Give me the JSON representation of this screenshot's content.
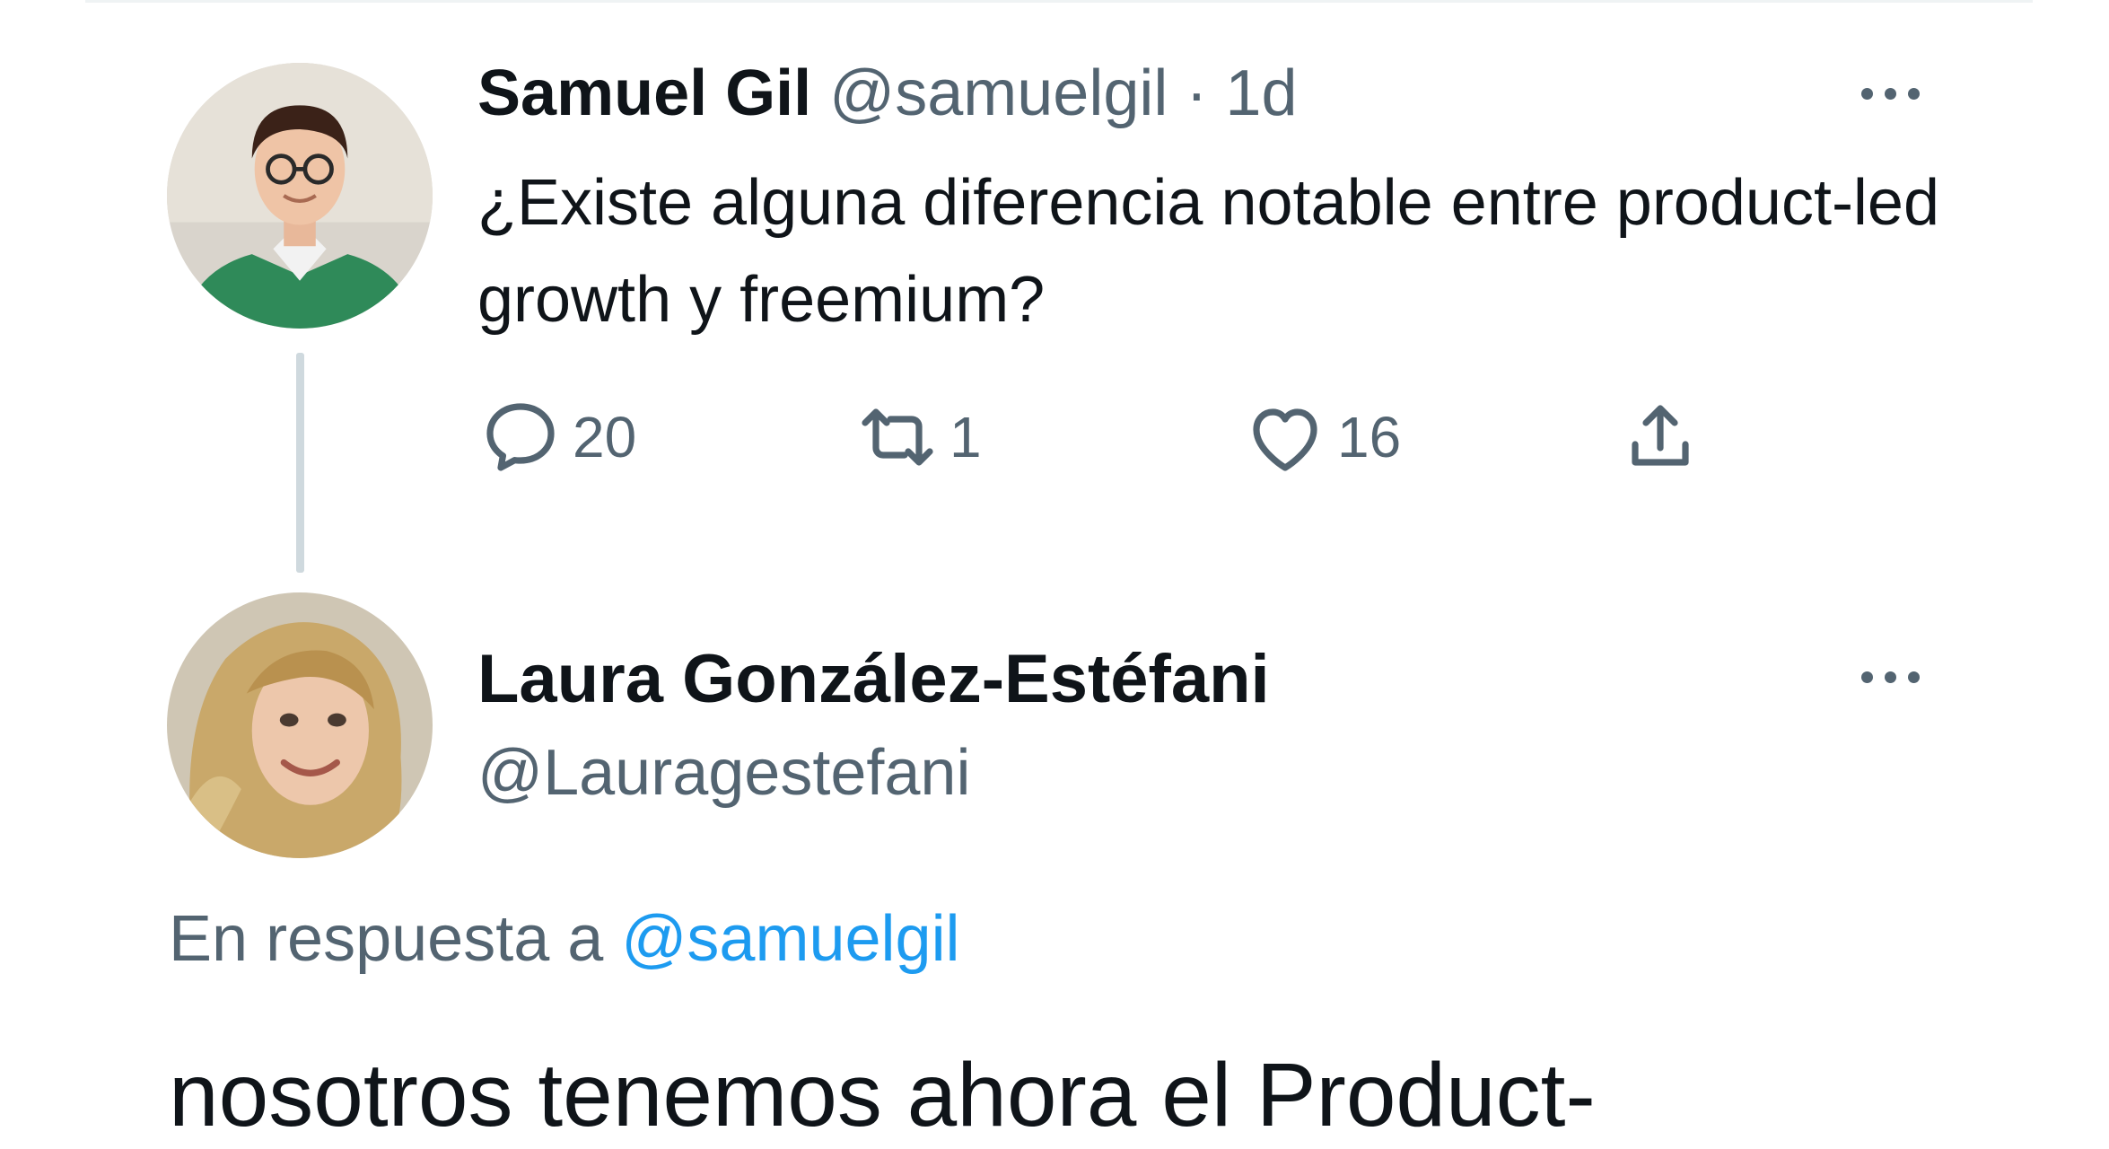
{
  "thread": {
    "parent": {
      "author_name": "Samuel Gil",
      "handle": "@samuelgil",
      "separator": "·",
      "time": "1d",
      "text": "¿Existe alguna diferencia notable entre product-led growth y freemium?",
      "reply_count": "20",
      "retweet_count": "1",
      "like_count": "16",
      "icons": [
        "reply-icon",
        "retweet-icon",
        "like-icon",
        "share-icon",
        "more-icon"
      ]
    },
    "reply": {
      "author_name": "Laura González-Estéfani",
      "handle": "@Lauragestefani",
      "replying_prefix": "En respuesta a",
      "replying_mention": "@samuelgil",
      "text_partial": "nosotros tenemos ahora el Product-"
    }
  },
  "colors": {
    "text_primary": "#0f1419",
    "text_secondary": "#536471",
    "link": "#1d9bf0",
    "thread_line": "#cfd9de"
  }
}
